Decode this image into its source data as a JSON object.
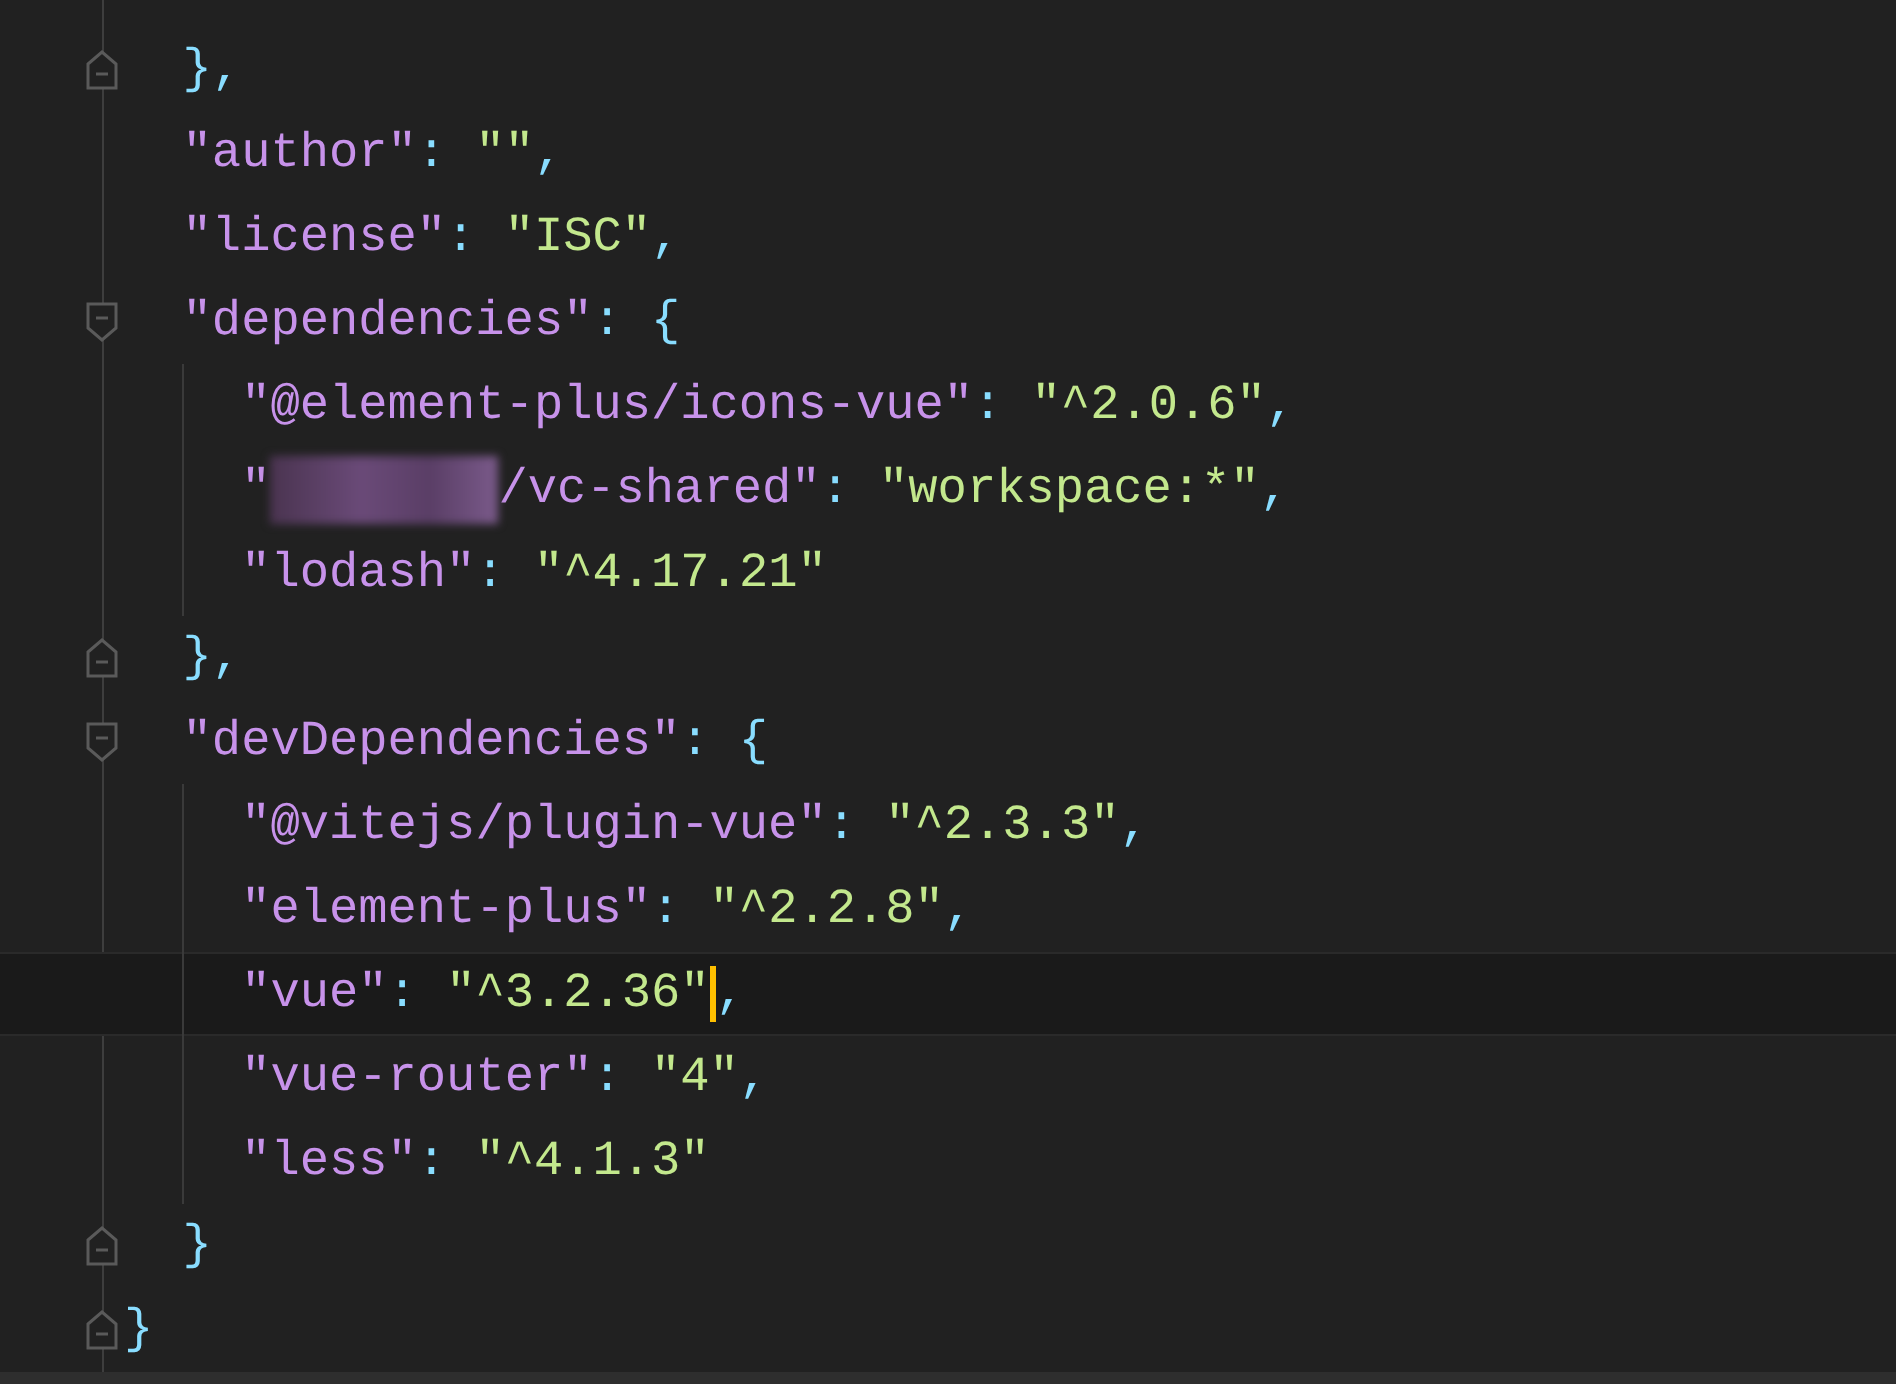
{
  "editor": {
    "lines": [
      {
        "children": [
          {
            "kind": "closer",
            "current": false,
            "tokens": [
              {
                "kind": "punct",
                "text": "},"
              }
            ]
          },
          {
            "current": false,
            "tokens": [
              {
                "kind": "key",
                "text": "\"author\""
              },
              {
                "kind": "punct",
                "text": ": "
              },
              {
                "kind": "string",
                "text": "\"\""
              },
              {
                "kind": "punct",
                "text": ","
              }
            ]
          },
          {
            "current": false,
            "tokens": [
              {
                "kind": "key",
                "text": "\"license\""
              },
              {
                "kind": "punct",
                "text": ": "
              },
              {
                "kind": "string",
                "text": "\"ISC\""
              },
              {
                "kind": "punct",
                "text": ","
              }
            ]
          },
          {
            "kind": "opener",
            "current": false,
            "tokens": [
              {
                "kind": "key",
                "text": "\"dependencies\""
              },
              {
                "kind": "punct",
                "text": ": {"
              }
            ],
            "children": [
              {
                "current": false,
                "tokens": [
                  {
                    "kind": "key",
                    "text": "\"@element-plus/icons-vue\""
                  },
                  {
                    "kind": "punct",
                    "text": ": "
                  },
                  {
                    "kind": "string",
                    "text": "\"^2.0.6\""
                  },
                  {
                    "kind": "punct",
                    "text": ","
                  }
                ]
              },
              {
                "current": false,
                "tokens": [
                  {
                    "kind": "key",
                    "text": "\""
                  },
                  {
                    "kind": "redacted"
                  },
                  {
                    "kind": "key",
                    "text": "/vc-shared\""
                  },
                  {
                    "kind": "punct",
                    "text": ": "
                  },
                  {
                    "kind": "string",
                    "text": "\"workspace:*\""
                  },
                  {
                    "kind": "punct",
                    "text": ","
                  }
                ]
              },
              {
                "current": false,
                "tokens": [
                  {
                    "kind": "key",
                    "text": "\"lodash\""
                  },
                  {
                    "kind": "punct",
                    "text": ": "
                  },
                  {
                    "kind": "string",
                    "text": "\"^4.17.21\""
                  }
                ]
              }
            ]
          },
          {
            "kind": "closer",
            "current": false,
            "tokens": [
              {
                "kind": "punct",
                "text": "},"
              }
            ]
          },
          {
            "kind": "opener",
            "current": false,
            "tokens": [
              {
                "kind": "key",
                "text": "\"devDependencies\""
              },
              {
                "kind": "punct",
                "text": ": {"
              }
            ],
            "children": [
              {
                "current": false,
                "tokens": [
                  {
                    "kind": "key",
                    "text": "\"@vitejs/plugin-vue\""
                  },
                  {
                    "kind": "punct",
                    "text": ": "
                  },
                  {
                    "kind": "string",
                    "text": "\"^2.3.3\""
                  },
                  {
                    "kind": "punct",
                    "text": ","
                  }
                ]
              },
              {
                "current": false,
                "tokens": [
                  {
                    "kind": "key",
                    "text": "\"element-plus\""
                  },
                  {
                    "kind": "punct",
                    "text": ": "
                  },
                  {
                    "kind": "string",
                    "text": "\"^2.2.8\""
                  },
                  {
                    "kind": "punct",
                    "text": ","
                  }
                ]
              },
              {
                "current": true,
                "tokens": [
                  {
                    "kind": "key",
                    "text": "\"vue\""
                  },
                  {
                    "kind": "punct",
                    "text": ": "
                  },
                  {
                    "kind": "string",
                    "text": "\"^3.2.36\""
                  },
                  {
                    "kind": "cursor"
                  },
                  {
                    "kind": "punct",
                    "text": ","
                  }
                ]
              },
              {
                "current": false,
                "tokens": [
                  {
                    "kind": "key",
                    "text": "\"vue-router\""
                  },
                  {
                    "kind": "punct",
                    "text": ": "
                  },
                  {
                    "kind": "string",
                    "text": "\"4\""
                  },
                  {
                    "kind": "punct",
                    "text": ","
                  }
                ]
              },
              {
                "current": false,
                "tokens": [
                  {
                    "kind": "key",
                    "text": "\"less\""
                  },
                  {
                    "kind": "punct",
                    "text": ": "
                  },
                  {
                    "kind": "string",
                    "text": "\"^4.1.3\""
                  }
                ]
              }
            ]
          },
          {
            "kind": "closer",
            "current": false,
            "tokens": [
              {
                "kind": "punct",
                "text": "}"
              }
            ]
          }
        ]
      },
      {
        "kind": "closer",
        "current": false,
        "tokens": [
          {
            "kind": "punct",
            "text": "}"
          }
        ]
      }
    ]
  }
}
